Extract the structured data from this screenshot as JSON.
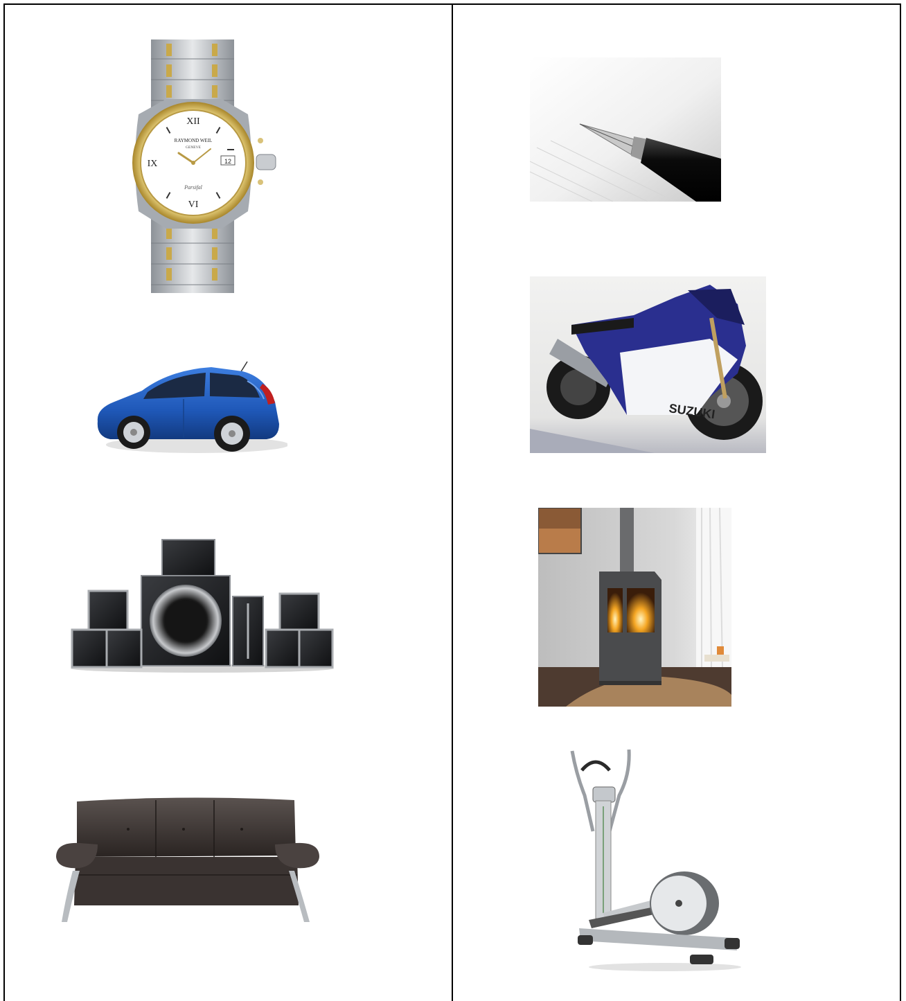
{
  "products": [
    {
      "icon": "wristwatch-icon",
      "dial_brand": "RAYMOND WEIL",
      "dial_city": "GENEVE",
      "dial_model": "Parsifal",
      "dial_date": "12",
      "dial_numerals": [
        "XII",
        "IX",
        "VI"
      ]
    },
    {
      "icon": "fountain-pen-icon"
    },
    {
      "icon": "hatchback-car-icon"
    },
    {
      "icon": "sport-motorcycle-icon",
      "fairing_brand": "SUZUKI"
    },
    {
      "icon": "speaker-system-icon"
    },
    {
      "icon": "wood-stove-icon"
    },
    {
      "icon": "leather-sofa-icon"
    },
    {
      "icon": "elliptical-trainer-icon"
    }
  ],
  "colors": {
    "border": "#000000",
    "watch_gold": "#c9a94a",
    "watch_steel": "#b8bcc2",
    "car_blue": "#1f58b8",
    "bike_blue": "#2a2f8f",
    "sofa_brown": "#3a3331",
    "stove_grey": "#4a4b4d"
  }
}
